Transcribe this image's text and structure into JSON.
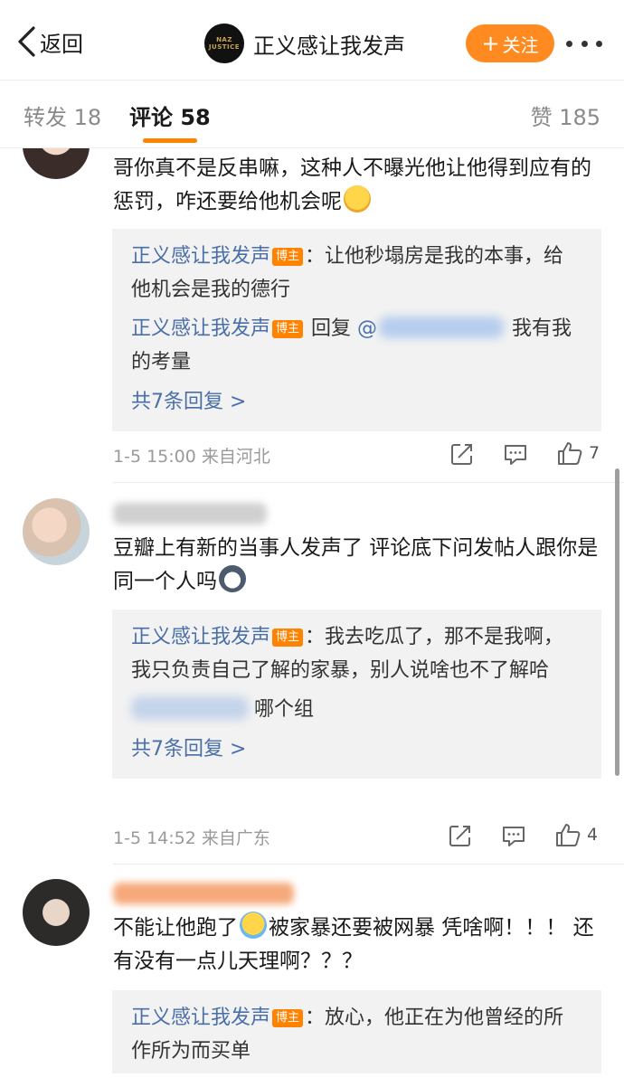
{
  "header": {
    "back_label": "返回",
    "account_name": "正义感让我发声",
    "avatar_text": "NAZ JUSTICE",
    "follow_label": "关注"
  },
  "tabs": {
    "repost": "转发 18",
    "comment": "评论 58",
    "like": "赞 185"
  },
  "colors": {
    "accent": "#ff8200",
    "follow_button": "#ff8a1f",
    "link": "#4a6fa8",
    "reply_bg": "#f2f2f2"
  },
  "comments": [
    {
      "text": "哥你真不是反串嘛，这种人不曝光他让他得到应有的惩罚，咋还要给他机会呢",
      "emoji": "tears-of-joy-emoji",
      "replies": [
        {
          "author": "正义感让我发声",
          "badge": "博主",
          "text": "：让他秒塌房是我的本事，给他机会是我的德行"
        },
        {
          "author": "正义感让我发声",
          "badge": "博主",
          "reply_word": "回复",
          "at": "@",
          "text": "我有我的考量"
        }
      ],
      "more_replies": "共7条回复 >",
      "meta": "1-5 15:00 来自河北",
      "like_count": "7"
    },
    {
      "text": "豆瓣上有新的当事人发声了 评论底下问发帖人跟你是同一个人吗",
      "emoji": "dog-face-emoji",
      "replies": [
        {
          "author": "正义感让我发声",
          "badge": "博主",
          "text": "：我去吃瓜了，那不是我啊，我只负责自己了解的家暴，别人说啥也不了解哈"
        },
        {
          "text": "哪个组"
        }
      ],
      "more_replies": "共7条回复 >",
      "meta": "1-5 14:52 来自广东",
      "like_count": "4"
    },
    {
      "text_before": "不能让他跑了",
      "emoji": "crying-emoji",
      "text_after": "被家暴还要被网暴 凭啥啊！！！ 还有没有一点儿天理啊？？？",
      "replies": [
        {
          "author": "正义感让我发声",
          "badge": "博主",
          "text": "：放心，他正在为他曾经的所作所为而买单"
        }
      ]
    }
  ]
}
